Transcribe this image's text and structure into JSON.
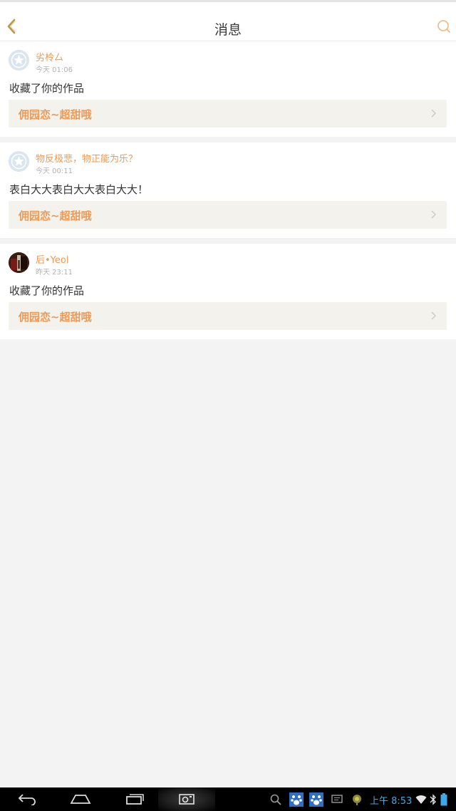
{
  "header": {
    "title": "消息",
    "back_icon": "chevron-left-icon",
    "search_icon": "search-icon",
    "accent": "#ec9a57"
  },
  "messages": [
    {
      "username": "劣柃厶",
      "time": "今天 01:06",
      "text": "收藏了你的作品",
      "work": "佣园恋~超甜哦",
      "avatar": "default-star-avatar"
    },
    {
      "username": "物反极悲，物正能为乐？",
      "time": "今天 00:11",
      "text": "表白大大表白大大表白大大！",
      "work": "佣园恋~超甜哦",
      "avatar": "default-star-avatar"
    },
    {
      "username": "后•Yeol",
      "time": "昨天 23:11",
      "text": "收藏了你的作品",
      "work": "佣园恋~超甜哦",
      "avatar": "photo-avatar"
    }
  ],
  "system_bar": {
    "clock": "上午 8:53",
    "clock_color": "#3fa9e8",
    "buttons": [
      "back-icon",
      "home-icon",
      "recents-icon",
      "screenshot-icon"
    ],
    "tray_icons": [
      "search-icon",
      "baidu-paw-icon",
      "baidu-paw-icon",
      "message-icon",
      "notification-icon",
      "wifi-icon",
      "bluetooth-icon",
      "battery-icon"
    ]
  }
}
